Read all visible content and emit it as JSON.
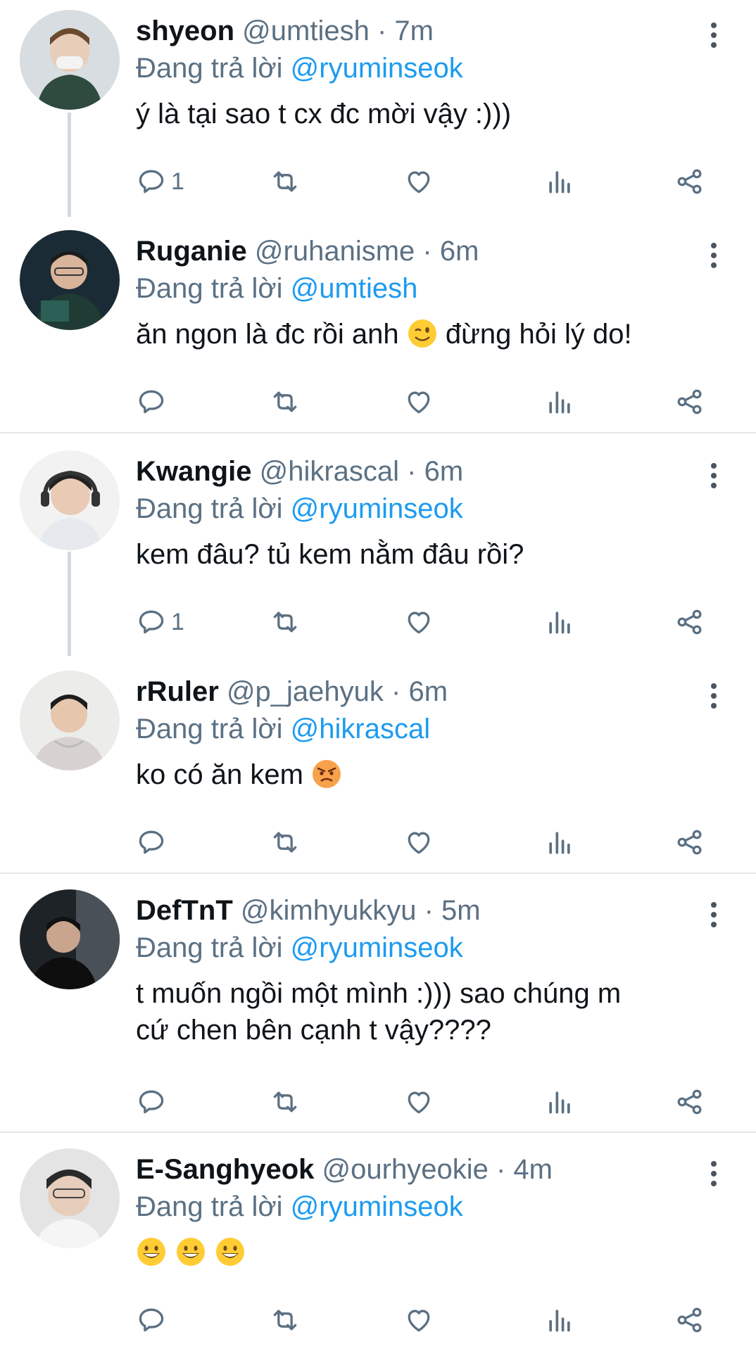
{
  "reply_prefix": "Đang trả lời",
  "colors": {
    "accent": "#1d9bf0",
    "secondary_text": "#5b7083",
    "divider": "#e3e7ea"
  },
  "icons": [
    "reply-icon",
    "retweet-icon",
    "like-icon",
    "analytics-icon",
    "share-icon",
    "more-icon"
  ],
  "tweets": [
    {
      "name": "shyeon",
      "handle": "@umtiesh",
      "time": "7m",
      "reply_to": "@ryuminseok",
      "text": "ý là tại sao t cx đc mời vậy :)))",
      "reply_count": "1",
      "emoji": []
    },
    {
      "name": "Ruganie",
      "handle": "@ruhanisme",
      "time": "6m",
      "reply_to": "@umtiesh",
      "text_before": "ăn ngon là đc rồi anh",
      "text_after": "đừng hỏi lý do!",
      "reply_count": "",
      "emoji": [
        "winking-face-emoji"
      ]
    },
    {
      "name": "Kwangie",
      "handle": "@hikrascal",
      "time": "6m",
      "reply_to": "@ryuminseok",
      "text": "kem đâu? tủ kem nằm đâu rồi?",
      "reply_count": "1",
      "emoji": []
    },
    {
      "name": "rRuler",
      "handle": "@p_jaehyuk",
      "time": "6m",
      "reply_to": "@hikrascal",
      "text": "ko có ăn kem",
      "reply_count": "",
      "emoji": [
        "angry-face-emoji"
      ]
    },
    {
      "name": "DefTnT",
      "handle": "@kimhyukkyu",
      "time": "5m",
      "reply_to": "@ryuminseok",
      "text_line1": "t muốn ngồi một mình :))) sao chúng m",
      "text_line2": "cứ chen bên cạnh t vậy????",
      "reply_count": "",
      "emoji": []
    },
    {
      "name": "E-Sanghyeok",
      "handle": "@ourhyeokie",
      "time": "4m",
      "reply_to": "@ryuminseok",
      "text": "",
      "reply_count": "",
      "emoji": [
        "grinning-face-emoji",
        "grinning-face-emoji",
        "grinning-face-emoji"
      ]
    }
  ]
}
